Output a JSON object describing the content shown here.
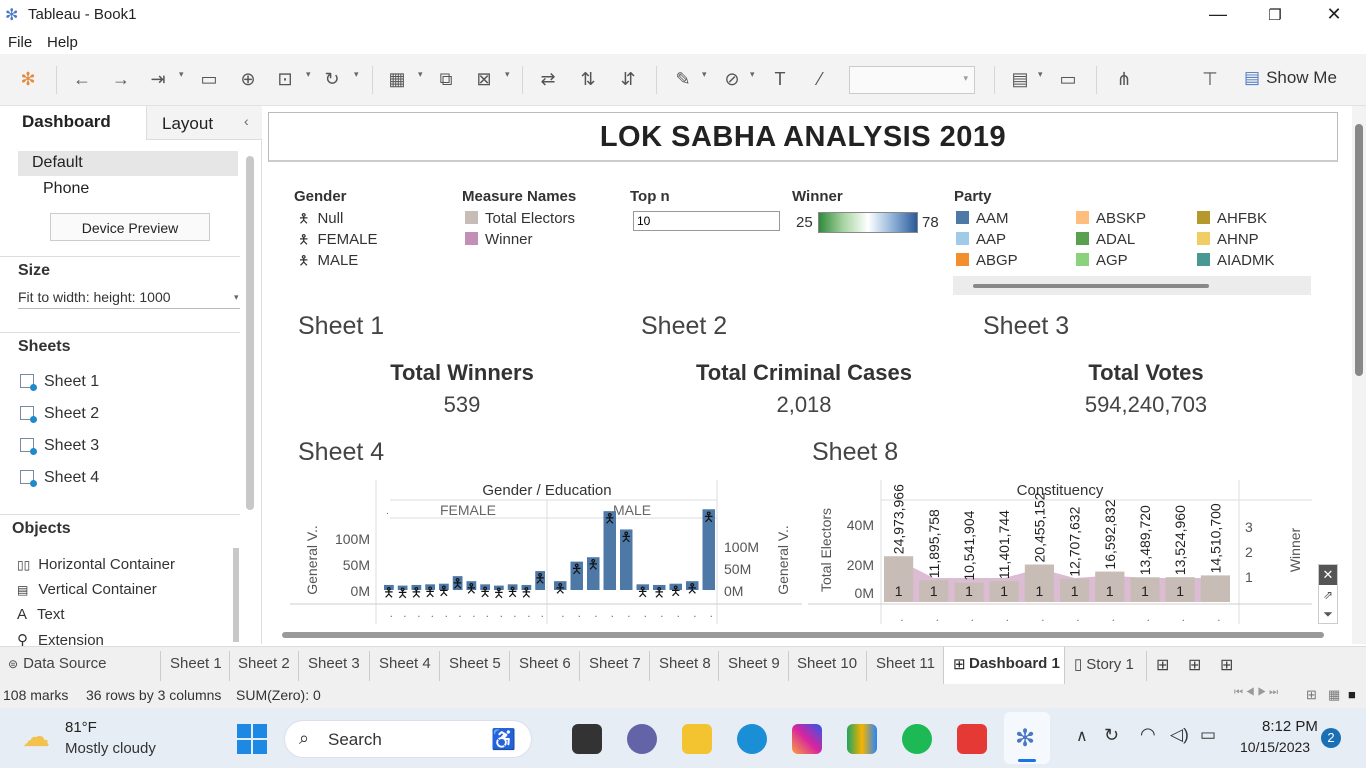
{
  "window": {
    "title": "Tableau - Book1"
  },
  "menu": [
    "File",
    "Help"
  ],
  "toolbar": {
    "show_me": "Show Me"
  },
  "left": {
    "tab_dashboard": "Dashboard",
    "tab_layout": "Layout",
    "device_default": "Default",
    "device_phone": "Phone",
    "device_preview": "Device Preview",
    "size_title": "Size",
    "size_value": "Fit to width: height: 1000",
    "sheets_title": "Sheets",
    "sheets": [
      "Sheet 1",
      "Sheet 2",
      "Sheet 3",
      "Sheet 4"
    ],
    "objects_title": "Objects",
    "objects": [
      "Horizontal Container",
      "Vertical Container",
      "Text",
      "Extension"
    ]
  },
  "dashboard": {
    "title": "LOK SABHA ANALYSIS 2019"
  },
  "legends": {
    "gender_title": "Gender",
    "gender_items": [
      "Null",
      "FEMALE",
      "MALE"
    ],
    "measure_title": "Measure Names",
    "measure_items": [
      {
        "label": "Total Electors",
        "color": "#c8bcb6"
      },
      {
        "label": "Winner",
        "color": "#c38fb6"
      }
    ],
    "topn_title": "Top n",
    "topn_value": "10",
    "winner_title": "Winner",
    "winner_min": "25",
    "winner_max": "78",
    "party_title": "Party",
    "party_items": [
      {
        "label": "AAM",
        "color": "#4e79a7"
      },
      {
        "label": "ABSKP",
        "color": "#ffbe7d"
      },
      {
        "label": "AHFBK",
        "color": "#b6992d"
      },
      {
        "label": "AAP",
        "color": "#a0cbe8"
      },
      {
        "label": "ADAL",
        "color": "#59a14f"
      },
      {
        "label": "AHNP",
        "color": "#f1ce63"
      },
      {
        "label": "ABGP",
        "color": "#f28e2b"
      },
      {
        "label": "AGP",
        "color": "#8cd17d"
      },
      {
        "label": "AIADMK",
        "color": "#499894"
      }
    ]
  },
  "sheets": {
    "s1": {
      "name": "Sheet 1",
      "label": "Total Winners",
      "value": "539"
    },
    "s2": {
      "name": "Sheet 2",
      "label": "Total Criminal Cases",
      "value": "2,018"
    },
    "s3": {
      "name": "Sheet 3",
      "label": "Total Votes",
      "value": "594,240,703"
    },
    "s4": {
      "name": "Sheet 4"
    },
    "s8": {
      "name": "Sheet 8"
    }
  },
  "chart_data": [
    {
      "type": "bar",
      "title": "Gender / Education",
      "ylabel": "General V..",
      "ylabel_right": "General V..",
      "panels": [
        "FEMALE",
        "MALE"
      ],
      "yticks": [
        "0M",
        "50M",
        "100M"
      ],
      "ylim": [
        0,
        130
      ],
      "series": [
        {
          "name": "FEMALE",
          "values": [
            8,
            7,
            8,
            9,
            10,
            22,
            14,
            9,
            7,
            9,
            8,
            30
          ]
        },
        {
          "name": "MALE",
          "values": [
            14,
            45,
            52,
            125,
            96,
            9,
            8,
            10,
            14,
            128
          ]
        }
      ]
    },
    {
      "type": "bar",
      "title": "Constituency",
      "ylabel": "Total Electors",
      "ylabel_right": "Winner",
      "yticks": [
        "0M",
        "20M",
        "40M"
      ],
      "yticks_right": [
        "1",
        "2",
        "3"
      ],
      "ylim": [
        0,
        48
      ],
      "series": [
        {
          "name": "Total Electors",
          "values": [
            24973966,
            11895758,
            10541904,
            11401744,
            20455152,
            12707632,
            16592832,
            13489720,
            13524960,
            14510700
          ]
        },
        {
          "name": "Winner",
          "values": [
            1,
            1,
            1,
            1,
            1,
            1,
            1,
            1,
            1,
            1
          ]
        }
      ],
      "value_labels": [
        "24,973,966",
        "11,895,758",
        "10,541,904",
        "11,401,744",
        "20,455,152",
        "12,707,632",
        "16,592,832",
        "13,489,720",
        "13,524,960",
        "14,510,700"
      ],
      "winner_labels": [
        "1",
        "1",
        "1",
        "1",
        "1",
        "1",
        "1",
        "1",
        "1"
      ]
    }
  ],
  "tabs": [
    "Data Source",
    "Sheet 1",
    "Sheet 2",
    "Sheet 3",
    "Sheet 4",
    "Sheet 5",
    "Sheet 6",
    "Sheet 7",
    "Sheet 8",
    "Sheet 9",
    "Sheet 10",
    "Sheet 11",
    "Dashboard 1",
    "Story 1"
  ],
  "status": {
    "marks": "108 marks",
    "rows": "36 rows by 3 columns",
    "sum": "SUM(Zero): 0"
  },
  "taskbar": {
    "temp": "81°F",
    "weather": "Mostly cloudy",
    "search": "Search",
    "time": "8:12 PM",
    "date": "10/15/2023",
    "badge": "2"
  }
}
